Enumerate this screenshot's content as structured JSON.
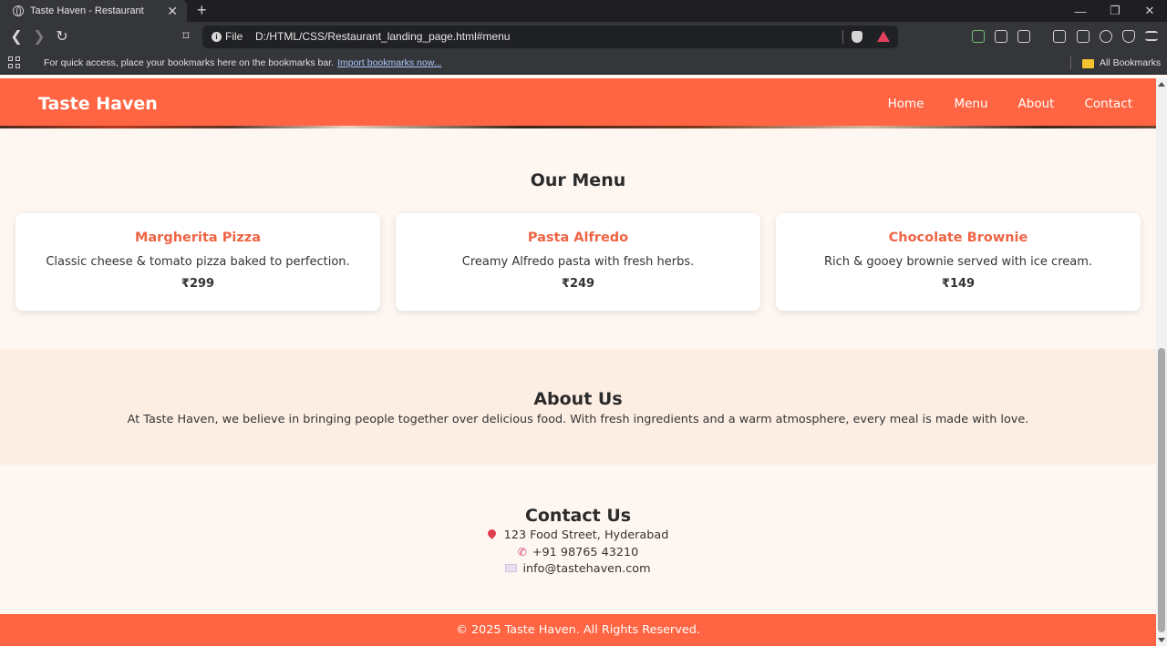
{
  "browser": {
    "tab_title": "Taste Haven - Restaurant",
    "tab_close": "✕",
    "new_tab": "+",
    "scheme_label": "File",
    "url": "D:/HTML/CSS/Restaurant_landing_page.html#menu",
    "bookmarks_hint": "For quick access, place your bookmarks here on the bookmarks bar.",
    "import_link": "Import bookmarks now...",
    "all_bookmarks": "All Bookmarks"
  },
  "site": {
    "logo": "Taste Haven",
    "nav": [
      "Home",
      "Menu",
      "About",
      "Contact"
    ],
    "accent_color": "#ff6542"
  },
  "menu": {
    "title": "Our Menu",
    "items": [
      {
        "name": "Margherita Pizza",
        "description": "Classic cheese & tomato pizza baked to perfection.",
        "price": "₹299"
      },
      {
        "name": "Pasta Alfredo",
        "description": "Creamy Alfredo pasta with fresh herbs.",
        "price": "₹249"
      },
      {
        "name": "Chocolate Brownie",
        "description": "Rich & gooey brownie served with ice cream.",
        "price": "₹149"
      }
    ]
  },
  "about": {
    "title": "About Us",
    "text": "At Taste Haven, we believe in bringing people together over delicious food. With fresh ingredients and a warm atmosphere, every meal is made with love."
  },
  "contact": {
    "title": "Contact Us",
    "address": "123 Food Street, Hyderabad",
    "phone": "+91 98765 43210",
    "email": "info@tastehaven.com"
  },
  "footer": {
    "text": "© 2025 Taste Haven. All Rights Reserved."
  }
}
